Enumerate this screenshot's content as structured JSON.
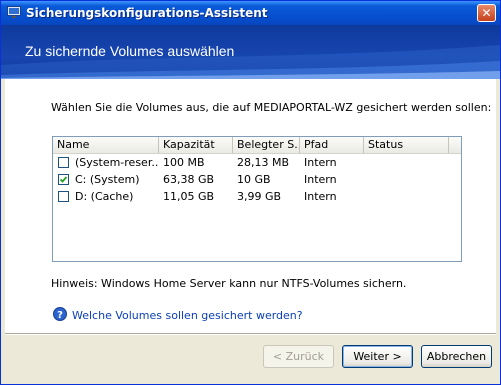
{
  "window": {
    "title": "Sicherungskonfigurations-Assistent",
    "close_label": "✕"
  },
  "header": {
    "title": "Zu sichernde Volumes auswählen"
  },
  "content": {
    "instruction": "Wählen Sie die Volumes aus, die auf MEDIAPORTAL-WZ gesichert werden sollen:",
    "columns": [
      "Name",
      "Kapazität",
      "Belegter S...",
      "Pfad",
      "Status"
    ],
    "rows": [
      {
        "checked": false,
        "name": "(System-reser...",
        "capacity": "100 MB",
        "used": "28,13 MB",
        "path": "Intern",
        "status": ""
      },
      {
        "checked": true,
        "name": "C: (System)",
        "capacity": "63,38 GB",
        "used": "10 GB",
        "path": "Intern",
        "status": ""
      },
      {
        "checked": false,
        "name": "D: (Cache)",
        "capacity": "11,05 GB",
        "used": "3,99 GB",
        "path": "Intern",
        "status": ""
      }
    ],
    "hint": "Hinweis: Windows Home Server kann nur NTFS-Volumes sichern.",
    "help_link": "Welche Volumes sollen gesichert werden?"
  },
  "buttons": {
    "back": "< Zurück",
    "next": "Weiter >",
    "cancel": "Abbrechen"
  },
  "colors": {
    "titlebar": "#0650d0",
    "header": "#1746b0",
    "dialog_face": "#ece9d8",
    "link": "#0b3fb5"
  },
  "icons": {
    "app": "wizard-app-icon",
    "help": "help-question-icon",
    "check": "checkmark-icon"
  }
}
